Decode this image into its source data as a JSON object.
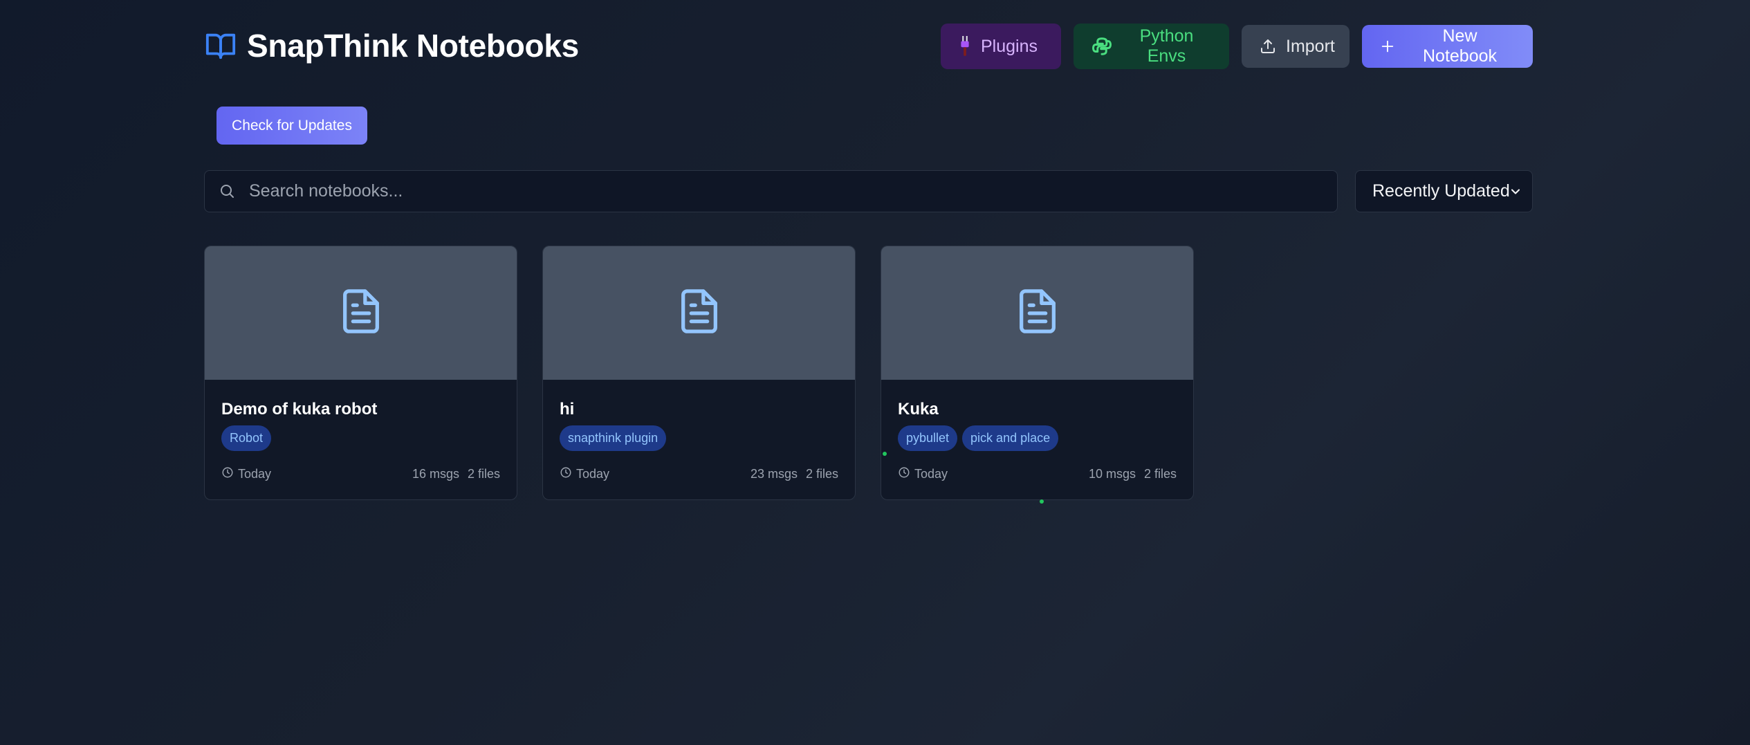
{
  "app": {
    "title": "SnapThink Notebooks",
    "brand_icon": "book-open-icon",
    "accent": "#6366f1"
  },
  "header": {
    "plugins_label": "Plugins",
    "python_envs_label": "Python Envs",
    "import_label": "Import",
    "new_notebook_label": "New Notebook"
  },
  "updates": {
    "check_label": "Check for Updates"
  },
  "search": {
    "placeholder": "Search notebooks...",
    "value": ""
  },
  "sort": {
    "selected": "Recently Updated"
  },
  "notebooks": [
    {
      "title": "Demo of kuka robot",
      "tags": [
        "Robot"
      ],
      "updated": "Today",
      "messages": "16 msgs",
      "files": "2 files",
      "icon": "file-text-icon"
    },
    {
      "title": "hi",
      "tags": [
        "snapthink plugin"
      ],
      "updated": "Today",
      "messages": "23 msgs",
      "files": "2 files",
      "icon": "file-text-icon"
    },
    {
      "title": "Kuka",
      "tags": [
        "pybullet",
        "pick and place"
      ],
      "updated": "Today",
      "messages": "10 msgs",
      "files": "2 files",
      "icon": "file-text-icon"
    }
  ]
}
